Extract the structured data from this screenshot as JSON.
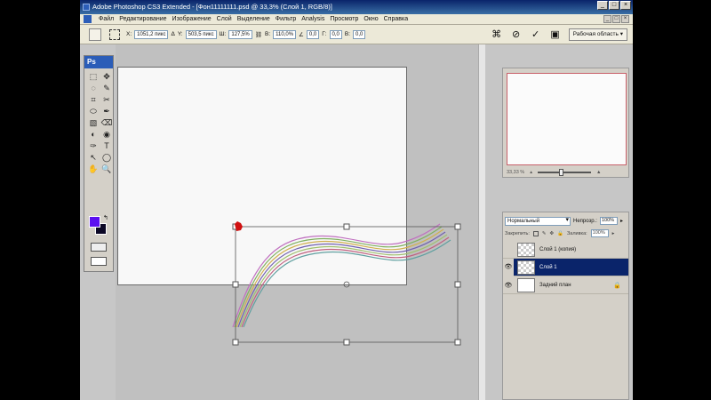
{
  "window": {
    "title": "Adobe Photoshop CS3 Extended - [Фон11111111.psd @ 33,3% (Слой 1, RGB/8)]",
    "buttons": [
      "_",
      "□",
      "×"
    ]
  },
  "menubar": {
    "items": [
      "Файл",
      "Редактирование",
      "Изображение",
      "Слой",
      "Выделение",
      "Фильтр",
      "Analysis",
      "Просмотр",
      "Окно",
      "Справка"
    ],
    "doc_buttons": [
      "_",
      "□",
      "×"
    ]
  },
  "options": {
    "x_label": "X:",
    "x_value": "1051,2 пикс",
    "delta": "Δ",
    "y_label": "Y:",
    "y_value": "503,5 пикс",
    "w_label": "Ш:",
    "w_value": "127,5%",
    "h_label": "В:",
    "h_value": "110,0%",
    "angle_value": "0,0",
    "g_label": "Г:",
    "g_value": "0,0",
    "v_label": "В:",
    "v_value": "0,0",
    "workspace": "Рабочая область ▾"
  },
  "toolbox": {
    "header": "Ps",
    "tools": [
      "⬚",
      "✥",
      "◌",
      "✎",
      "⌗",
      "✂",
      "⬭",
      "✒",
      "▧",
      "⌫",
      "◐",
      "◉",
      "✑",
      "T",
      "↖",
      "◯",
      "✋",
      "🔍"
    ],
    "fg_color": "#5b0ff0",
    "bg_color": "#0c0826"
  },
  "navigator": {
    "zoom": "33,33 %"
  },
  "layers_panel": {
    "blend_mode": "Нормальный",
    "opacity_label": "Непрозр.:",
    "opacity_value": "100%",
    "lock_label": "Закрепить:",
    "fill_label": "Заливка:",
    "fill_value": "100%",
    "layers": [
      {
        "name": "Слой 1 (копия)",
        "visible": false,
        "selected": false
      },
      {
        "name": "Слой 1",
        "visible": true,
        "selected": true
      },
      {
        "name": "Задний план",
        "visible": true,
        "selected": false,
        "locked": true
      }
    ]
  },
  "colors": {
    "title_bar": "#0a246a",
    "selected_layer": "#0a246a",
    "navigator_frame": "#c8606a"
  }
}
